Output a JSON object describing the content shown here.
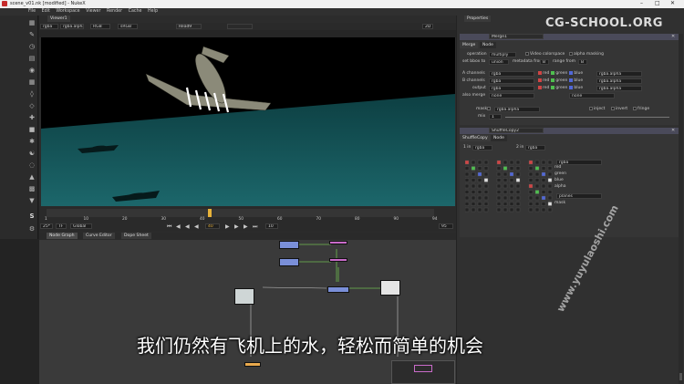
{
  "window": {
    "title": "scene_v01.nk [modified] - NukeX"
  },
  "menu": [
    "File",
    "Edit",
    "Workspace",
    "Viewer",
    "Render",
    "Cache",
    "Help"
  ],
  "watermark": "CG-SCHOOL.ORG",
  "watermark_vertical": "www.yuyulaoshi.com",
  "subtitle": "我们仍然有飞机上的水，轻松而简单的机会",
  "viewer": {
    "tab": "Viewer1",
    "channels": "rgba",
    "channel_alpha": "rgba.alpha",
    "colorspace": "RGB",
    "zoom_select": "sRGB",
    "read_a": "Read9",
    "mode": "2D",
    "info": "HD_1080 1920x1080  bbox: 0 0 1920 1080 channels: rgba",
    "coords": "x=0 y=0"
  },
  "timeline": {
    "ticks": [
      "1",
      "10",
      "20",
      "30",
      "40",
      "50",
      "60",
      "70",
      "80",
      "90",
      "94"
    ],
    "fps": "25*",
    "tf": "TF",
    "global": "Global",
    "frame": "40",
    "step": "10",
    "end": "95",
    "playhead_frac": 0.42
  },
  "bottom_tabs": [
    "Node Graph",
    "Curve Editor",
    "Dope Sheet"
  ],
  "properties": {
    "tab": "Properties",
    "merge": {
      "name": "Merge1",
      "tabs": [
        "Merge",
        "Node"
      ],
      "operation_label": "operation",
      "operation": "multiply",
      "video_colorspace": "Video colorspace",
      "alpha_masking": "alpha masking",
      "set_bbox_label": "set bbox to",
      "set_bbox": "union",
      "metadata_label": "metadata from",
      "metadata": "B",
      "range_label": "range from",
      "range": "B",
      "a_label": "A channels",
      "a": "rgba",
      "a_alpha": "rgba.alpha",
      "b_label": "B channels",
      "b": "rgba",
      "b_alpha": "rgba.alpha",
      "output_label": "output",
      "output": "rgba",
      "output_alpha": "rgba.alpha",
      "also_merge_label": "also merge",
      "also_merge": "none",
      "also_merge_b": "none",
      "ch_red": "red",
      "ch_green": "green",
      "ch_blue": "blue",
      "mask_label": "mask",
      "mask": "rgba.alpha",
      "inject": "inject",
      "invert": "invert",
      "fringe": "fringe",
      "mix_label": "mix",
      "mix": "1"
    },
    "shuffle": {
      "name": "ShuffleCopy2",
      "tabs": [
        "ShuffleCopy",
        "Node"
      ],
      "in1_label": "1 in",
      "in1": "rgba",
      "in2_label": "2 in",
      "in2": "rgba",
      "out": "rgba",
      "outputs": [
        "red",
        "green",
        "blue",
        "alpha"
      ],
      "out2": "planes",
      "mask": "mask"
    }
  }
}
